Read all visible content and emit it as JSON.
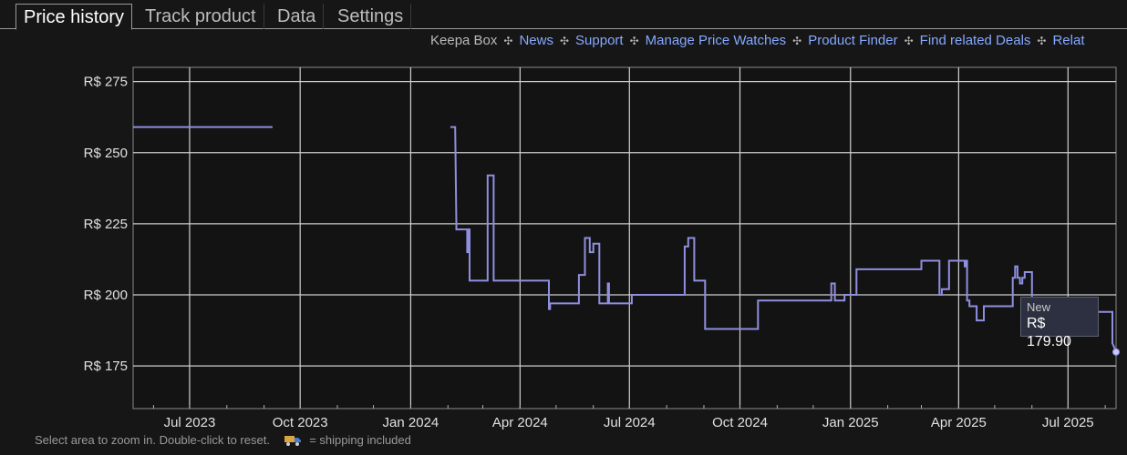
{
  "tabs": [
    {
      "label": "Price history",
      "active": true
    },
    {
      "label": "Track product",
      "active": false
    },
    {
      "label": "Data",
      "active": false
    },
    {
      "label": "Settings",
      "active": false
    }
  ],
  "links": {
    "keepa_box": "Keepa Box",
    "news": "News",
    "support": "Support",
    "manage_price_watches": "Manage Price Watches",
    "product_finder": "Product Finder",
    "find_related_deals": "Find related Deals",
    "related_truncated": "Relat",
    "separator": "✣"
  },
  "colors": {
    "background": "#161616",
    "grid": "#d0d0d0",
    "series_new": "#8f8fe0",
    "link": "#86a8ff",
    "tooltip_bg": "#2c3040"
  },
  "tooltip": {
    "label": "New",
    "value": "R$ 179.90"
  },
  "footer": {
    "hint": "Select area to zoom in. Double-click to reset.",
    "shipping": "= shipping included",
    "truck_icon": "truck-icon"
  },
  "chart_data": {
    "type": "line",
    "x_axis": "date",
    "y_unit": "R$",
    "ylim": [
      160,
      280
    ],
    "xlim": [
      "2023-05-15",
      "2025-08-10"
    ],
    "grid": true,
    "y_ticks": [
      {
        "value": 175,
        "label": "R$ 175"
      },
      {
        "value": 200,
        "label": "R$ 200"
      },
      {
        "value": 225,
        "label": "R$ 225"
      },
      {
        "value": 250,
        "label": "R$ 250"
      },
      {
        "value": 275,
        "label": "R$ 275"
      }
    ],
    "x_ticks": [
      {
        "date": "2023-07-01",
        "label": "Jul 2023"
      },
      {
        "date": "2023-10-01",
        "label": "Oct 2023"
      },
      {
        "date": "2024-01-01",
        "label": "Jan 2024"
      },
      {
        "date": "2024-04-01",
        "label": "Apr 2024"
      },
      {
        "date": "2024-07-01",
        "label": "Jul 2024"
      },
      {
        "date": "2024-10-01",
        "label": "Oct 2024"
      },
      {
        "date": "2025-01-01",
        "label": "Jan 2025"
      },
      {
        "date": "2025-04-01",
        "label": "Apr 2025"
      },
      {
        "date": "2025-07-01",
        "label": "Jul 2025"
      }
    ],
    "series": [
      {
        "name": "New",
        "segments": [
          [
            [
              "2023-05-15",
              259
            ],
            [
              "2023-09-08",
              259
            ]
          ],
          [
            [
              "2024-02-03",
              259
            ],
            [
              "2024-02-05",
              259
            ],
            [
              "2024-02-07",
              259
            ],
            [
              "2024-02-08",
              225
            ],
            [
              "2024-02-08",
              223
            ],
            [
              "2024-02-17",
              223
            ],
            [
              "2024-02-17",
              215
            ],
            [
              "2024-02-18",
              215
            ],
            [
              "2024-02-18",
              223
            ],
            [
              "2024-02-19",
              223
            ],
            [
              "2024-02-19",
              205
            ],
            [
              "2024-03-05",
              205
            ],
            [
              "2024-03-05",
              242
            ],
            [
              "2024-03-10",
              242
            ],
            [
              "2024-03-10",
              205
            ],
            [
              "2024-04-25",
              205
            ],
            [
              "2024-04-25",
              195
            ],
            [
              "2024-04-26",
              195
            ],
            [
              "2024-04-26",
              197
            ],
            [
              "2024-05-20",
              197
            ],
            [
              "2024-05-20",
              207
            ],
            [
              "2024-05-25",
              207
            ],
            [
              "2024-05-25",
              220
            ],
            [
              "2024-05-29",
              220
            ],
            [
              "2024-05-29",
              215
            ],
            [
              "2024-06-01",
              215
            ],
            [
              "2024-06-01",
              218
            ],
            [
              "2024-06-06",
              218
            ],
            [
              "2024-06-06",
              197
            ],
            [
              "2024-06-13",
              197
            ],
            [
              "2024-06-13",
              204
            ],
            [
              "2024-06-14",
              204
            ],
            [
              "2024-06-14",
              197
            ],
            [
              "2024-07-03",
              197
            ],
            [
              "2024-07-03",
              200
            ],
            [
              "2024-08-16",
              200
            ],
            [
              "2024-08-16",
              217
            ],
            [
              "2024-08-19",
              217
            ],
            [
              "2024-08-19",
              220
            ],
            [
              "2024-08-24",
              220
            ],
            [
              "2024-08-24",
              205
            ],
            [
              "2024-09-02",
              205
            ],
            [
              "2024-09-02",
              188
            ],
            [
              "2024-10-16",
              188
            ],
            [
              "2024-10-16",
              198
            ],
            [
              "2024-12-16",
              198
            ],
            [
              "2024-12-16",
              204
            ],
            [
              "2024-12-19",
              204
            ],
            [
              "2024-12-19",
              198
            ],
            [
              "2024-12-27",
              198
            ],
            [
              "2024-12-27",
              200
            ],
            [
              "2025-01-06",
              200
            ],
            [
              "2025-01-06",
              209
            ],
            [
              "2025-03-01",
              209
            ],
            [
              "2025-03-01",
              212
            ],
            [
              "2025-03-16",
              212
            ],
            [
              "2025-03-16",
              200
            ],
            [
              "2025-03-18",
              200
            ],
            [
              "2025-03-18",
              202
            ],
            [
              "2025-03-24",
              202
            ],
            [
              "2025-03-24",
              212
            ],
            [
              "2025-04-06",
              212
            ],
            [
              "2025-04-06",
              210
            ],
            [
              "2025-04-07",
              210
            ],
            [
              "2025-04-07",
              212
            ],
            [
              "2025-04-08",
              212
            ],
            [
              "2025-04-08",
              198
            ],
            [
              "2025-04-10",
              198
            ],
            [
              "2025-04-10",
              196
            ],
            [
              "2025-04-16",
              196
            ],
            [
              "2025-04-16",
              191
            ],
            [
              "2025-04-22",
              191
            ],
            [
              "2025-04-22",
              196
            ],
            [
              "2025-05-16",
              196
            ],
            [
              "2025-05-16",
              206
            ],
            [
              "2025-05-18",
              206
            ],
            [
              "2025-05-18",
              210
            ],
            [
              "2025-05-20",
              210
            ],
            [
              "2025-05-20",
              206
            ],
            [
              "2025-05-22",
              206
            ],
            [
              "2025-05-22",
              204
            ],
            [
              "2025-05-24",
              204
            ],
            [
              "2025-05-24",
              206
            ],
            [
              "2025-05-26",
              206
            ],
            [
              "2025-05-26",
              208
            ],
            [
              "2025-06-01",
              208
            ],
            [
              "2025-06-01",
              194
            ],
            [
              "2025-08-07",
              194
            ],
            [
              "2025-08-07",
              183
            ],
            [
              "2025-08-10",
              180
            ]
          ]
        ]
      }
    ],
    "tooltip_point": {
      "x": "2025-08-10",
      "y": 179.9
    }
  }
}
